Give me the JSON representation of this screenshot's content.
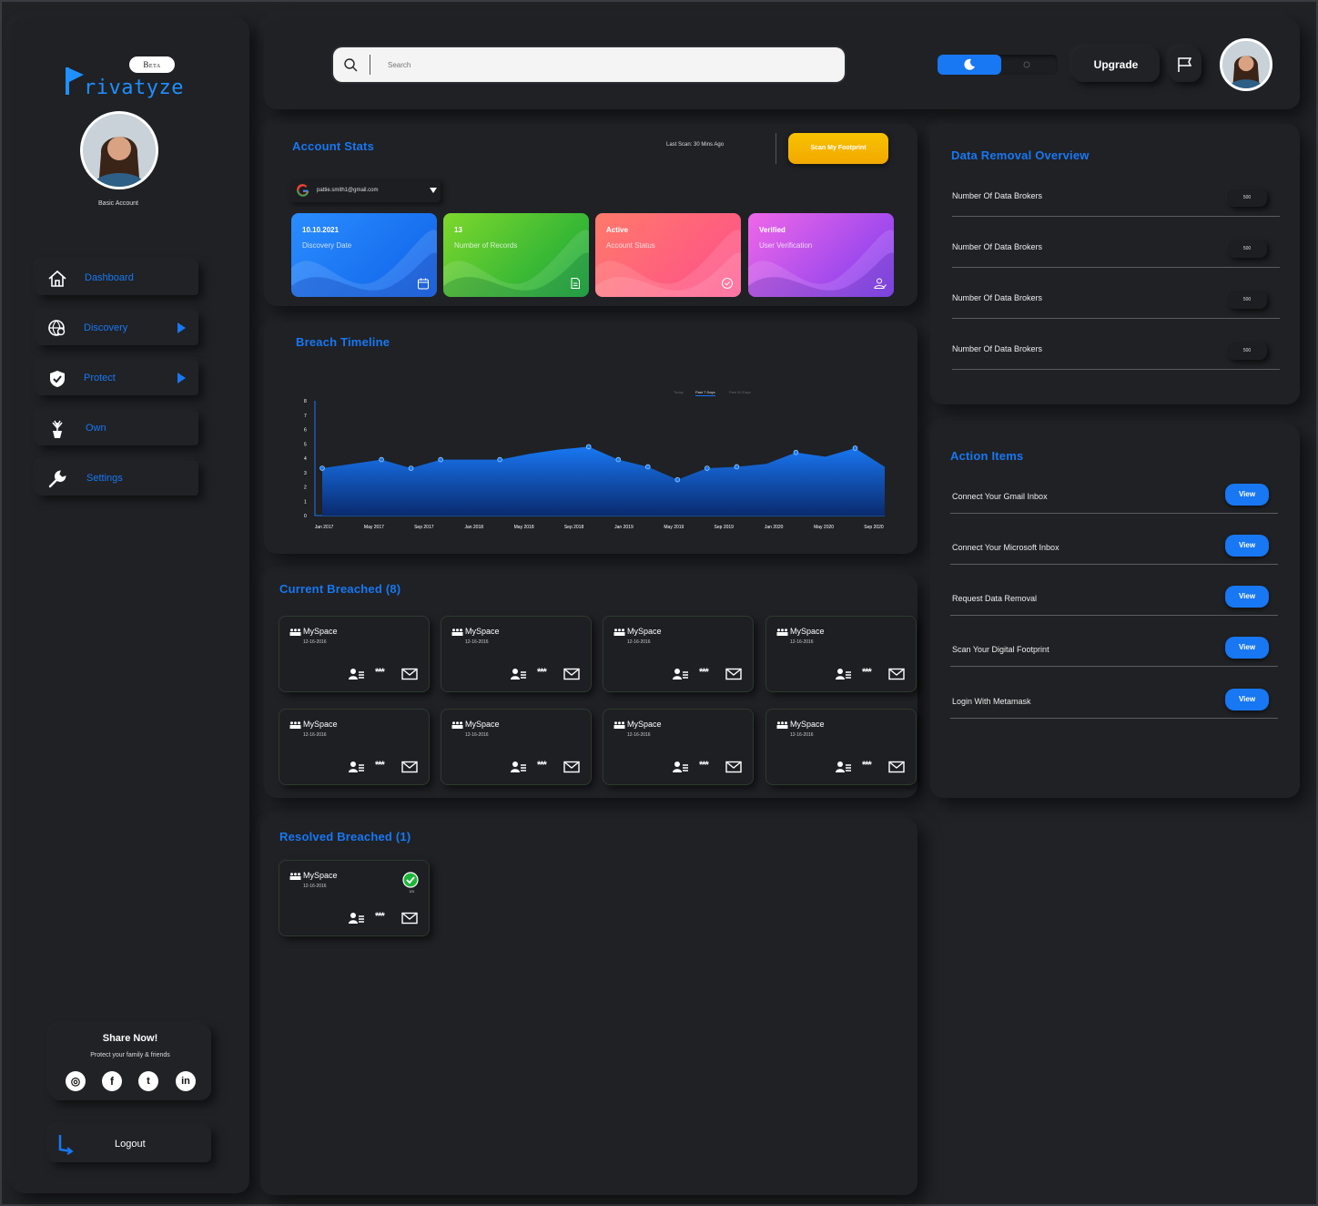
{
  "app": {
    "beta": "Beta",
    "logo_rest": "rivatyze"
  },
  "sidebar": {
    "account_label": "Basic Account",
    "items": [
      {
        "label": "Dashboard"
      },
      {
        "label": "Discovery"
      },
      {
        "label": "Protect"
      },
      {
        "label": "Own"
      },
      {
        "label": "Settings"
      }
    ],
    "share": {
      "title": "Share Now!",
      "subtitle": "Protect your family & friends"
    },
    "logout": "Logout"
  },
  "topbar": {
    "search_placeholder": "Search",
    "upgrade": "Upgrade"
  },
  "stats": {
    "title": "Account Stats",
    "last_scan": "Last Scan: 30 Mins Ago",
    "scan_button": "Scan My Footprint",
    "email": "pattie.smith1@gmail.com",
    "cards": [
      {
        "value": "10.10.2021",
        "label": "Discovery Date"
      },
      {
        "value": "13",
        "label": "Number of Records"
      },
      {
        "value": "Active",
        "label": "Account Status"
      },
      {
        "value": "Verified",
        "label": "User Verification"
      }
    ]
  },
  "timeline": {
    "title": "Breach Timeline",
    "filters": [
      "Today",
      "Past 7 Days",
      "Past 30 Days"
    ],
    "active_filter": "Past 7 Days"
  },
  "chart_data": {
    "type": "area",
    "ylim": [
      0,
      8
    ],
    "yticks": [
      "0",
      "1",
      "2",
      "3",
      "4",
      "5",
      "6",
      "7",
      "8"
    ],
    "xticks": [
      "Jan 2017",
      "May 2017",
      "Sep 2017",
      "Jan 2018",
      "May 2018",
      "Sep 2018",
      "Jan 2019",
      "May 2019",
      "Sep 2019",
      "Jan 2020",
      "May 2020",
      "Sep 2020"
    ],
    "points": [
      3.3,
      3.6,
      3.9,
      3.3,
      3.9,
      3.9,
      3.9,
      4.3,
      4.6,
      4.8,
      3.9,
      3.4,
      2.5,
      3.3,
      3.4,
      3.6,
      4.4,
      4.1,
      4.7,
      3.4
    ],
    "color": "#1877f2"
  },
  "current": {
    "title": "Current Breached (8)",
    "cards": [
      {
        "name": "MySpace",
        "date": "12-16-2016"
      },
      {
        "name": "MySpace",
        "date": "12-16-2016"
      },
      {
        "name": "MySpace",
        "date": "12-16-2016"
      },
      {
        "name": "MySpace",
        "date": "12-16-2016"
      },
      {
        "name": "MySpace",
        "date": "12-16-2016"
      },
      {
        "name": "MySpace",
        "date": "12-16-2016"
      },
      {
        "name": "MySpace",
        "date": "12-16-2016"
      },
      {
        "name": "MySpace",
        "date": "12-16-2016"
      }
    ],
    "stars": "***"
  },
  "resolved": {
    "title": "Resolved Breached (1)",
    "card": {
      "name": "MySpace",
      "date": "12-16-2016",
      "count": "3/3"
    }
  },
  "removal": {
    "title": "Data Removal Overview",
    "rows": [
      {
        "label": "Number Of Data Brokers",
        "value": "500"
      },
      {
        "label": "Number Of Data Brokers",
        "value": "500"
      },
      {
        "label": "Number Of Data Brokers",
        "value": "500"
      },
      {
        "label": "Number Of Data Brokers",
        "value": "500"
      }
    ]
  },
  "actions": {
    "title": "Action Items",
    "button": "View",
    "items": [
      {
        "label": "Connect Your Gmail Inbox"
      },
      {
        "label": "Connect Your Microsoft Inbox"
      },
      {
        "label": "Request Data Removal"
      },
      {
        "label": "Scan Your Digital Footprint"
      },
      {
        "label": "Login With Metamask"
      }
    ]
  },
  "colors": {
    "accent": "#1877f2",
    "scan": "#f5b400",
    "bg": "#202226"
  }
}
